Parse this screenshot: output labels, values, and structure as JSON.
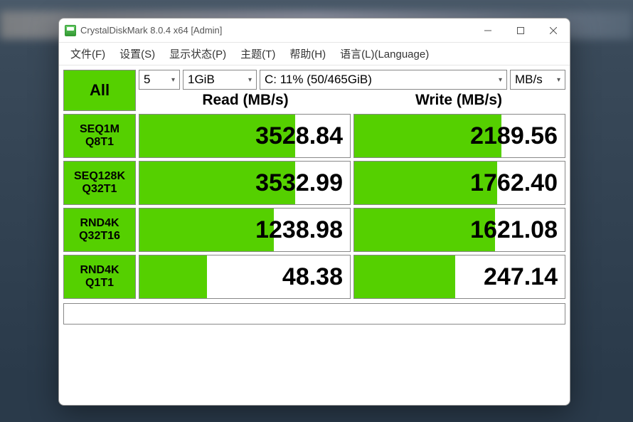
{
  "title": "CrystalDiskMark 8.0.4 x64 [Admin]",
  "menu": {
    "file": "文件(F)",
    "settings": "设置(S)",
    "profile": "显示状态(P)",
    "theme": "主题(T)",
    "help": "帮助(H)",
    "language": "语言(L)(Language)"
  },
  "controls": {
    "all": "All",
    "runs": "5",
    "size": "1GiB",
    "drive": "C: 11% (50/465GiB)",
    "unit": "MB/s",
    "read_header": "Read (MB/s)",
    "write_header": "Write (MB/s)"
  },
  "rows": [
    {
      "l1": "SEQ1M",
      "l2": "Q8T1",
      "read": "3528.84",
      "rp": 74,
      "write": "2189.56",
      "wp": 70
    },
    {
      "l1": "SEQ128K",
      "l2": "Q32T1",
      "read": "3532.99",
      "rp": 74,
      "write": "1762.40",
      "wp": 68
    },
    {
      "l1": "RND4K",
      "l2": "Q32T16",
      "read": "1238.98",
      "rp": 64,
      "write": "1621.08",
      "wp": 67
    },
    {
      "l1": "RND4K",
      "l2": "Q1T1",
      "read": "48.38",
      "rp": 32,
      "write": "247.14",
      "wp": 48
    }
  ],
  "chart_data": {
    "type": "bar",
    "title": "CrystalDiskMark 8.0.4 — C: 11% (50/465GiB), 5 runs, 1GiB",
    "categories": [
      "SEQ1M Q8T1",
      "SEQ128K Q32T1",
      "RND4K Q32T16",
      "RND4K Q1T1"
    ],
    "series": [
      {
        "name": "Read (MB/s)",
        "values": [
          3528.84,
          3532.99,
          1238.98,
          48.38
        ]
      },
      {
        "name": "Write (MB/s)",
        "values": [
          2189.56,
          1762.4,
          1621.08,
          247.14
        ]
      }
    ],
    "ylabel": "MB/s"
  }
}
